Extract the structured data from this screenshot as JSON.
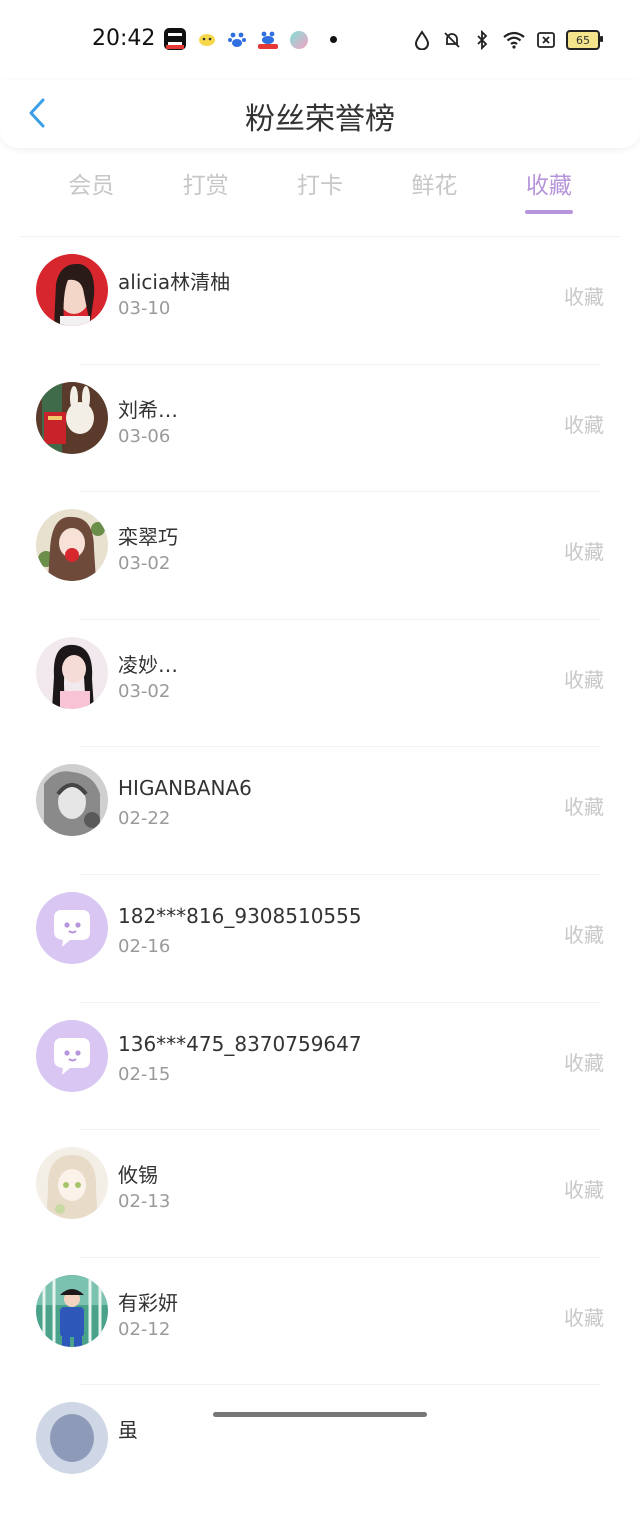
{
  "status_bar": {
    "time": "20:42",
    "battery": "65",
    "app_icons": [
      "capcut-icon",
      "emoji-app-icon",
      "baidu-icon",
      "baidu-map-icon",
      "circle-app-icon"
    ],
    "system_icons": [
      "drop-icon",
      "bell-off-icon",
      "bluetooth-icon",
      "wifi-icon",
      "sim-off-icon"
    ]
  },
  "header": {
    "title": "粉丝荣誉榜"
  },
  "tabs": [
    {
      "label": "会员",
      "active": false
    },
    {
      "label": "打赏",
      "active": false
    },
    {
      "label": "打卡",
      "active": false
    },
    {
      "label": "鲜花",
      "active": false
    },
    {
      "label": "收藏",
      "active": true
    }
  ],
  "colors": {
    "accent": "#b695da",
    "muted": "#c8c8c8",
    "avatar_default_bg": "#d9c6f3"
  },
  "fans": [
    {
      "name": "alicia林清柚",
      "date": "03-10",
      "action": "收藏",
      "avatar": "photo-red"
    },
    {
      "name": "刘希…",
      "date": "03-06",
      "action": "收藏",
      "avatar": "bunny"
    },
    {
      "name": "栾翠巧",
      "date": "03-02",
      "action": "收藏",
      "avatar": "anime-girl"
    },
    {
      "name": "凌妙…",
      "date": "03-02",
      "action": "收藏",
      "avatar": "photo-pink"
    },
    {
      "name": "HIGANBANA6",
      "date": "02-22",
      "action": "收藏",
      "avatar": "sketch-gray"
    },
    {
      "name": "182***816_9308510555",
      "date": "02-16",
      "action": "收藏",
      "avatar": "default-chat"
    },
    {
      "name": "136***475_8370759647",
      "date": "02-15",
      "action": "收藏",
      "avatar": "default-chat"
    },
    {
      "name": "攸锡",
      "date": "02-13",
      "action": "收藏",
      "avatar": "anime-light"
    },
    {
      "name": "有彩妍",
      "date": "02-12",
      "action": "收藏",
      "avatar": "photo-blue"
    },
    {
      "name": "虽",
      "date": "",
      "action": "",
      "avatar": "partial"
    }
  ]
}
